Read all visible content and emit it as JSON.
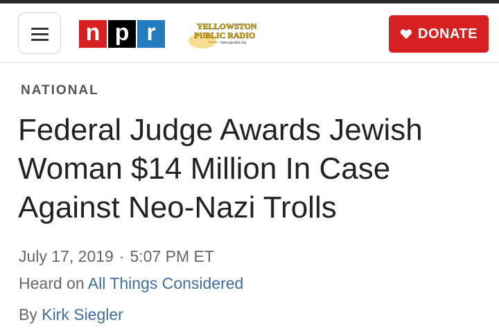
{
  "header": {
    "menu_icon": "hamburger-menu-icon",
    "npr_logo_letters": [
      "n",
      "p",
      "r"
    ],
    "station_logo_text": [
      "YELLOWSTONE",
      "PUBLIC RADIO",
      "www.ypradio.org"
    ],
    "donate_label": "DONATE",
    "donate_icon": "heart-icon",
    "colors": {
      "npr_red": "#d62021",
      "npr_black": "#000000",
      "npr_blue": "#237bbd",
      "donate_bg": "#d62021"
    }
  },
  "article": {
    "section": "NATIONAL",
    "headline": "Federal Judge Awards Jewish Woman $14 Million In Case Against Neo-Nazi Trolls",
    "date": "July 17, 2019",
    "separator": "·",
    "time": "5:07 PM ET",
    "heard_on_prefix": "Heard on ",
    "program": "All Things Considered",
    "by_prefix": "By ",
    "author": "Kirk Siegler"
  }
}
